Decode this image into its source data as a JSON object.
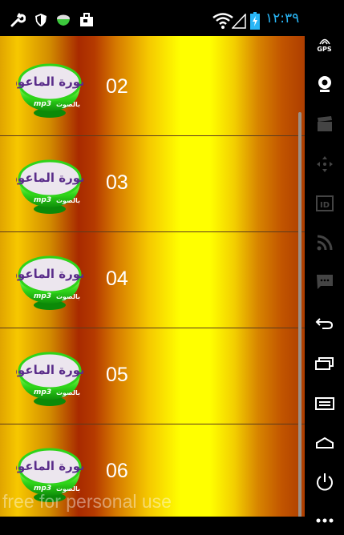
{
  "status_bar": {
    "time": "١٢:٣٩",
    "notification_icons": [
      "wrench-icon",
      "shield-icon",
      "bowl-icon",
      "bag-icon"
    ],
    "system_icons": [
      "wifi-icon",
      "signal-icon",
      "battery-charging-icon"
    ],
    "time_color": "#29b6f6"
  },
  "list": {
    "items": [
      {
        "label": "02",
        "icon": "surah-al-maun-mp3-icon"
      },
      {
        "label": "03",
        "icon": "surah-al-maun-mp3-icon"
      },
      {
        "label": "04",
        "icon": "surah-al-maun-mp3-icon"
      },
      {
        "label": "05",
        "icon": "surah-al-maun-mp3-icon"
      },
      {
        "label": "06",
        "icon": "surah-al-maun-mp3-icon"
      }
    ],
    "icon_text_top": "سورة الماعون",
    "icon_text_bottom": "بالصوت",
    "icon_text_mp3": "mp3"
  },
  "watermark": "free for personal use",
  "side_panel": {
    "gps_label": "GPS",
    "buttons": [
      "gps-icon",
      "camera-icon",
      "video-icon",
      "dpad-icon",
      "id-icon",
      "rss-icon",
      "sms-icon",
      "back-icon",
      "recent-apps-icon",
      "menu-icon",
      "home-icon",
      "power-icon",
      "more-icon"
    ]
  },
  "colors": {
    "gradient_dark_red": "#a82a00",
    "gradient_yellow": "#ffff00",
    "bowl_green": "#2fd41a",
    "label_text": "#ffffff"
  }
}
